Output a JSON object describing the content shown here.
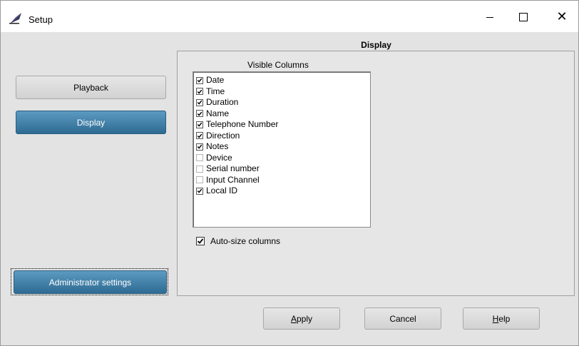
{
  "window": {
    "title": "Setup",
    "icon": "setup-feather-icon",
    "controls": {
      "minimize": "minimize-icon",
      "maximize": "maximize-icon",
      "close": "✕"
    }
  },
  "sidebar": {
    "items": [
      {
        "label": "Playback",
        "selected": false
      },
      {
        "label": "Display",
        "selected": true
      }
    ],
    "admin_label": "Administrator settings"
  },
  "main": {
    "section_title": "Display",
    "list_title": "Visible Columns",
    "columns": [
      {
        "label": "Date",
        "checked": true
      },
      {
        "label": "Time",
        "checked": true
      },
      {
        "label": "Duration",
        "checked": true
      },
      {
        "label": "Name",
        "checked": true
      },
      {
        "label": "Telephone Number",
        "checked": true
      },
      {
        "label": "Direction",
        "checked": true
      },
      {
        "label": "Notes",
        "checked": true
      },
      {
        "label": "Device",
        "checked": false
      },
      {
        "label": "Serial number",
        "checked": false
      },
      {
        "label": "Input Channel",
        "checked": false
      },
      {
        "label": "Local ID",
        "checked": true
      }
    ],
    "autosize": {
      "label": "Auto-size columns",
      "checked": true
    }
  },
  "buttons": {
    "apply_first": "A",
    "apply_rest": "pply",
    "cancel": "Cancel",
    "help_first": "H",
    "help_rest": "elp"
  },
  "colors": {
    "selected_button": "#2e6b93",
    "window_bg": "#e3e3e3"
  }
}
